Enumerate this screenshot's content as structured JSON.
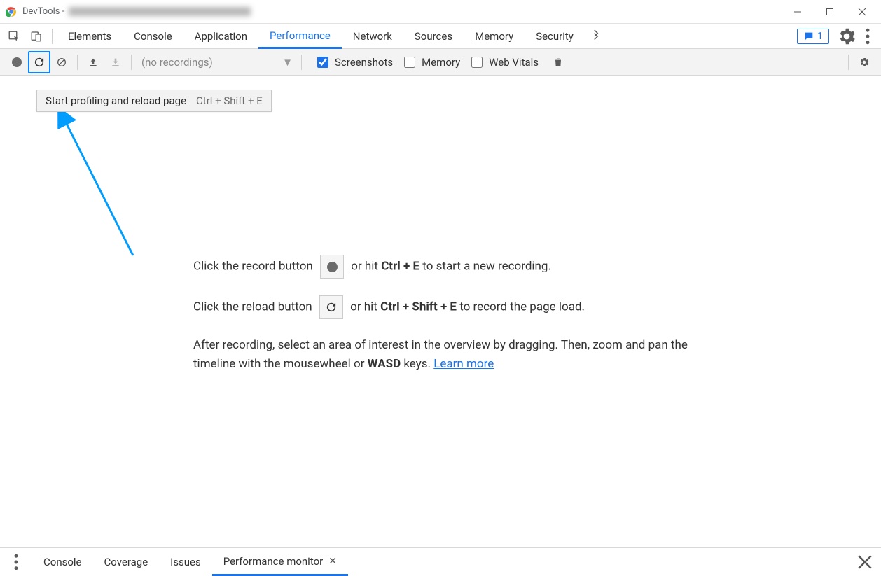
{
  "title_prefix": "DevTools -",
  "tabs": {
    "elements": "Elements",
    "console": "Console",
    "application": "Application",
    "performance": "Performance",
    "network": "Network",
    "sources": "Sources",
    "memory": "Memory",
    "security": "Security"
  },
  "issues_count": "1",
  "toolbar": {
    "recordings_placeholder": "(no recordings)",
    "screenshots": "Screenshots",
    "memory": "Memory",
    "web_vitals": "Web Vitals"
  },
  "tooltip": {
    "text": "Start profiling and reload page",
    "shortcut": "Ctrl + Shift + E"
  },
  "instructions": {
    "p1_a": "Click the record button ",
    "p1_b": " or hit ",
    "p1_kbd": "Ctrl + E",
    "p1_c": " to start a new recording.",
    "p2_a": "Click the reload button ",
    "p2_b": " or hit ",
    "p2_kbd": "Ctrl + Shift + E",
    "p2_c": " to record the page load.",
    "p3_a": "After recording, select an area of interest in the overview by dragging. Then, zoom and pan the timeline with the mousewheel or ",
    "p3_kbd": "WASD",
    "p3_b": " keys. ",
    "learn_more": "Learn more"
  },
  "drawer": {
    "console": "Console",
    "coverage": "Coverage",
    "issues": "Issues",
    "perf_monitor": "Performance monitor"
  }
}
